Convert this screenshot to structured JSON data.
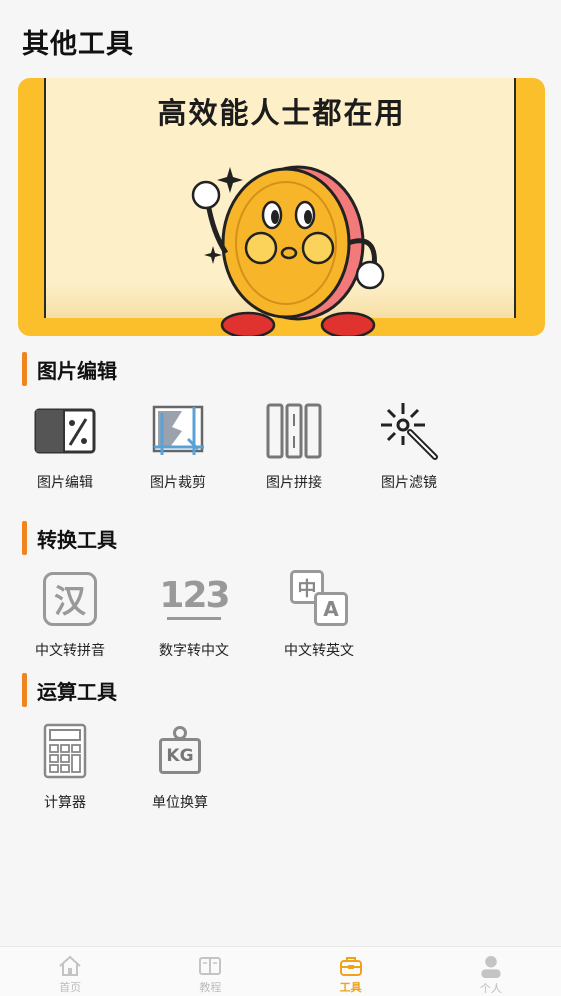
{
  "header": {
    "title": "其他工具"
  },
  "banner": {
    "text": "高效能人士都在用"
  },
  "sections": [
    {
      "title": "图片编辑",
      "tools": [
        {
          "label": "图片编辑",
          "icon": "image-edit-icon"
        },
        {
          "label": "图片裁剪",
          "icon": "image-crop-icon"
        },
        {
          "label": "图片拼接",
          "icon": "image-stitch-icon"
        },
        {
          "label": "图片滤镜",
          "icon": "magic-wand-icon"
        }
      ]
    },
    {
      "title": "转换工具",
      "tools": [
        {
          "label": "中文转拼音",
          "icon": "hanzi-icon",
          "glyph": "汉"
        },
        {
          "label": "数字转中文",
          "icon": "numbers-icon",
          "glyph": "123"
        },
        {
          "label": "中文转英文",
          "icon": "translate-icon",
          "glyph_a": "中",
          "glyph_b": "A"
        }
      ]
    },
    {
      "title": "运算工具",
      "tools": [
        {
          "label": "计算器",
          "icon": "calculator-icon"
        },
        {
          "label": "单位换算",
          "icon": "weight-kg-icon",
          "glyph": "KG"
        }
      ]
    }
  ],
  "tabbar": [
    {
      "label": "首页",
      "icon": "home-icon",
      "active": false
    },
    {
      "label": "教程",
      "icon": "book-icon",
      "active": false
    },
    {
      "label": "工具",
      "icon": "toolbox-icon",
      "active": true
    },
    {
      "label": "个人",
      "icon": "person-icon",
      "active": false
    }
  ],
  "colors": {
    "accent": "#f0851f",
    "active_tab": "#f0a21a",
    "banner_bg": "#fbbf2c"
  }
}
